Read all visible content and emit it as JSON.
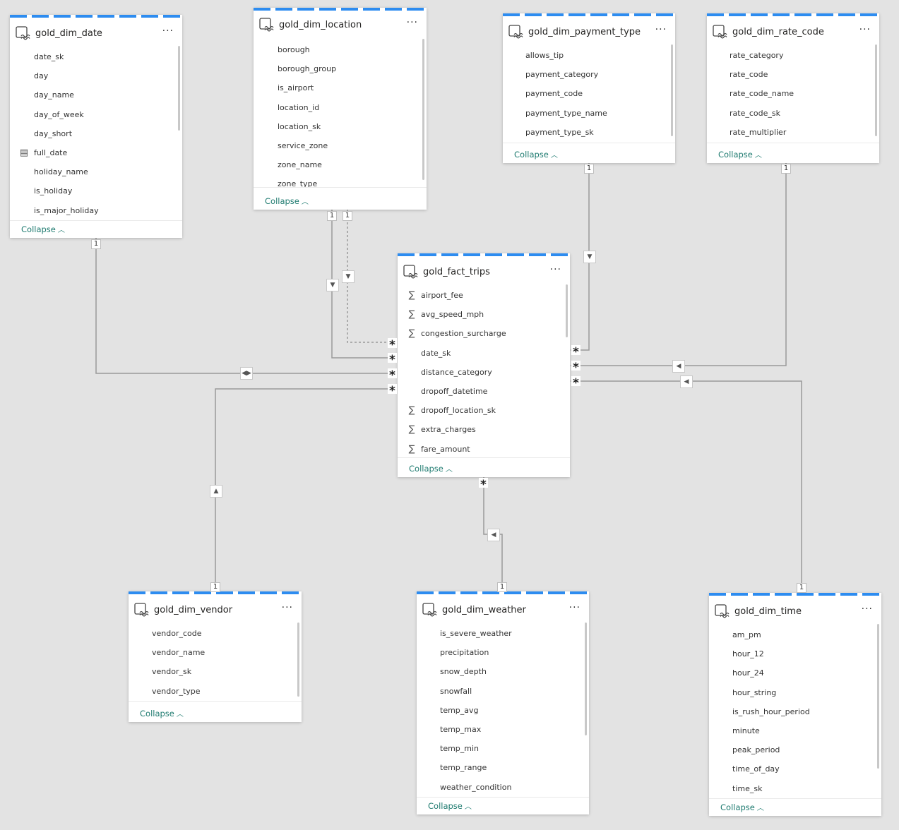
{
  "tables": {
    "date": {
      "title": "gold_dim_date",
      "fields": [
        "date_sk",
        "day",
        "day_name",
        "day_of_week",
        "day_short",
        "full_date",
        "holiday_name",
        "is_holiday",
        "is_major_holiday"
      ],
      "collapse": "Collapse"
    },
    "location": {
      "title": "gold_dim_location",
      "fields": [
        "borough",
        "borough_group",
        "is_airport",
        "location_id",
        "location_sk",
        "service_zone",
        "zone_name",
        "zone_type"
      ],
      "collapse": "Collapse"
    },
    "payment": {
      "title": "gold_dim_payment_type",
      "fields": [
        "allows_tip",
        "payment_category",
        "payment_code",
        "payment_type_name",
        "payment_type_sk"
      ],
      "collapse": "Collapse"
    },
    "rate": {
      "title": "gold_dim_rate_code",
      "fields": [
        "rate_category",
        "rate_code",
        "rate_code_name",
        "rate_code_sk",
        "rate_multiplier"
      ],
      "collapse": "Collapse"
    },
    "fact": {
      "title": "gold_fact_trips",
      "fields": [
        "airport_fee",
        "avg_speed_mph",
        "congestion_surcharge",
        "date_sk",
        "distance_category",
        "dropoff_datetime",
        "dropoff_location_sk",
        "extra_charges",
        "fare_amount"
      ],
      "collapse": "Collapse"
    },
    "vendor": {
      "title": "gold_dim_vendor",
      "fields": [
        "vendor_code",
        "vendor_name",
        "vendor_sk",
        "vendor_type"
      ],
      "collapse": "Collapse"
    },
    "weather": {
      "title": "gold_dim_weather",
      "fields": [
        "is_severe_weather",
        "precipitation",
        "snow_depth",
        "snowfall",
        "temp_avg",
        "temp_max",
        "temp_min",
        "temp_range",
        "weather_condition"
      ],
      "collapse": "Collapse"
    },
    "time": {
      "title": "gold_dim_time",
      "fields": [
        "am_pm",
        "hour_12",
        "hour_24",
        "hour_string",
        "is_rush_hour_period",
        "minute",
        "peak_period",
        "time_of_day",
        "time_sk"
      ],
      "collapse": "Collapse"
    }
  },
  "field_icons": {
    "date": [
      "",
      "",
      "",
      "",
      "",
      "calendar-icon",
      "",
      "",
      ""
    ],
    "fact": [
      "sigma-icon",
      "sigma-icon",
      "sigma-icon",
      "",
      "",
      "",
      "sigma-icon",
      "sigma-icon",
      "sigma-icon"
    ]
  },
  "card_menu": "···",
  "cardinality": {
    "one": "1",
    "many": "*"
  },
  "colors": {
    "accent": "#2d8cf0",
    "link": "#1d7a6f",
    "line": "#9a9a9a"
  }
}
